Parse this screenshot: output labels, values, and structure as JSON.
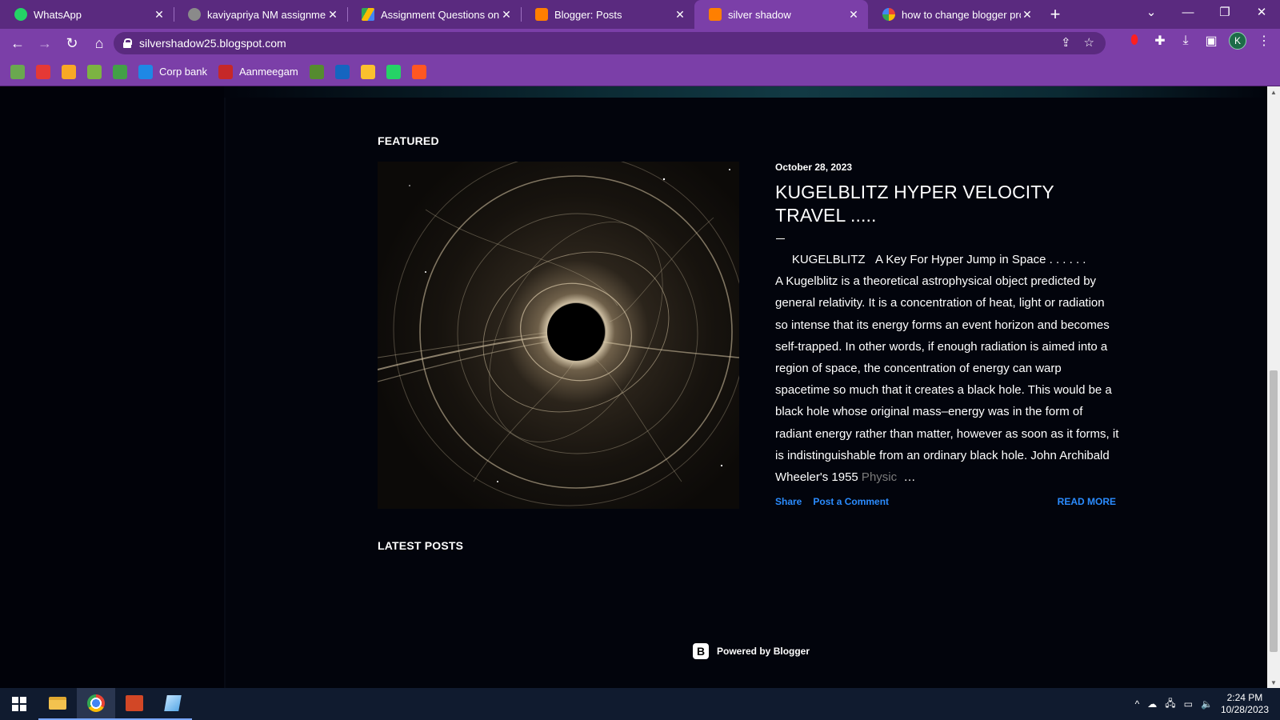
{
  "browser": {
    "tabs": [
      {
        "title": "WhatsApp",
        "favicon_color": "#25d366",
        "active": false
      },
      {
        "title": "kaviyapriya NM assignment d",
        "favicon_color": "#8a8a8a",
        "active": false
      },
      {
        "title": "Assignment Questions on Di",
        "favicon_color": "#fbbc04",
        "active": false
      },
      {
        "title": "Blogger: Posts",
        "favicon_color": "#ff7f00",
        "active": false
      },
      {
        "title": "silver shadow",
        "favicon_color": "#ff7f00",
        "active": true
      },
      {
        "title": "how to change blogger profi",
        "favicon_color": "#4285f4",
        "active": false
      }
    ],
    "new_tab_symbol": "+",
    "url": "silvershadow25.blogspot.com",
    "profile_initial": "K",
    "bookmarks": [
      {
        "label": "",
        "color": "#6aa84f"
      },
      {
        "label": "",
        "color": "#e53935"
      },
      {
        "label": "",
        "color": "#f9a825"
      },
      {
        "label": "",
        "color": "#7cb342"
      },
      {
        "label": "",
        "color": "#43a047"
      },
      {
        "label": "Corp bank",
        "color": "#1e88e5"
      },
      {
        "label": "Aanmeegam",
        "color": "#c62828"
      },
      {
        "label": "",
        "color": "#558b2f"
      },
      {
        "label": "",
        "color": "#1565c0"
      },
      {
        "label": "",
        "color": "#fbc02d"
      },
      {
        "label": "",
        "color": "#25d366"
      },
      {
        "label": "",
        "color": "#ff5722"
      }
    ]
  },
  "blog": {
    "featured_heading": "FEATURED",
    "latest_heading": "LATEST POSTS",
    "post": {
      "date": "October 28, 2023",
      "title": "KUGELBLITZ HYPER VELOCITY TRAVEL .....",
      "excerpt_lead": "     KUGELBLITZ   A Key For Hyper Jump in Space . . . . . .",
      "excerpt": "A Kugelblitz is a theoretical astrophysical object predicted by  general relativity. It is a concentration of heat, light or radiation so intense that its energy forms an event horizon and becomes self-trapped. In other words, if enough radiation is aimed into a region of space, the concentration of energy can warp spacetime so much that it creates a black hole. This would be a black hole whose original mass–energy was in the form of radiant energy rather than matter, however as soon as it forms, it is indistinguishable from an ordinary black hole. John Archibald Wheeler's 1955",
      "excerpt_fade": " Physic",
      "ellipsis": "  …",
      "share_label": "Share",
      "comment_label": "Post a Comment",
      "read_more_label": "READ MORE"
    },
    "powered_by": "Powered by Blogger"
  },
  "taskbar": {
    "time": "2:24 PM",
    "date": "10/28/2023"
  }
}
